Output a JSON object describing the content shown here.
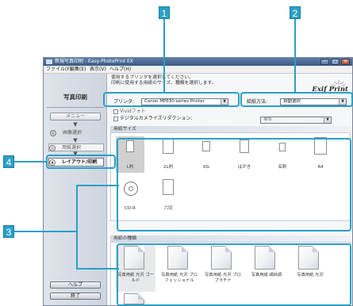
{
  "window": {
    "title": "新規写真印刷 - Easy-PhotoPrint EX",
    "menus": [
      "ファイル(F)",
      "編集(E)",
      "表示(V)",
      "ヘルプ(H)"
    ],
    "controls": [
      "–",
      "□",
      "×"
    ]
  },
  "sidebar": {
    "title": "写真印刷",
    "menu_label": "メニュー",
    "steps": [
      {
        "num": "①",
        "label": "画像選択"
      },
      {
        "num": "②",
        "label": "用紙選択"
      },
      {
        "num": "③",
        "label": "レイアウト/印刷"
      }
    ],
    "help_label": "ヘルプ",
    "exit_label": "終了"
  },
  "main": {
    "hint_line1": "使用するプリンタを選択してください。",
    "hint_line2": "印刷に使用する用紙のサイズ、種類を選択します。",
    "brand": "Exif Print",
    "printer_label": "プリンタ:",
    "printer_value": "Canon MP630 series Printer",
    "feed_label": "給紙方法:",
    "feed_value": "自動選択",
    "vivid_label": "Vividフォト",
    "dc_label": "デジタルカメライズリダクション:",
    "dc_value": "標準",
    "size_section": "用紙サイズ",
    "sizes": [
      "L判",
      "2L判",
      "KG",
      "はがき",
      "名刺",
      "A4",
      "CD-R",
      "六切"
    ],
    "type_section": "用紙の種類",
    "media": [
      "写真用紙 光沢 ゴールド",
      "写真用紙 光沢 プロフェッショナル",
      "写真用紙 光沢 プロプラチナ",
      "写真用紙 絹目調",
      "写真用紙 光沢"
    ]
  },
  "callouts": [
    "1",
    "2",
    "3",
    "4"
  ],
  "accent": "#2aa0c8"
}
